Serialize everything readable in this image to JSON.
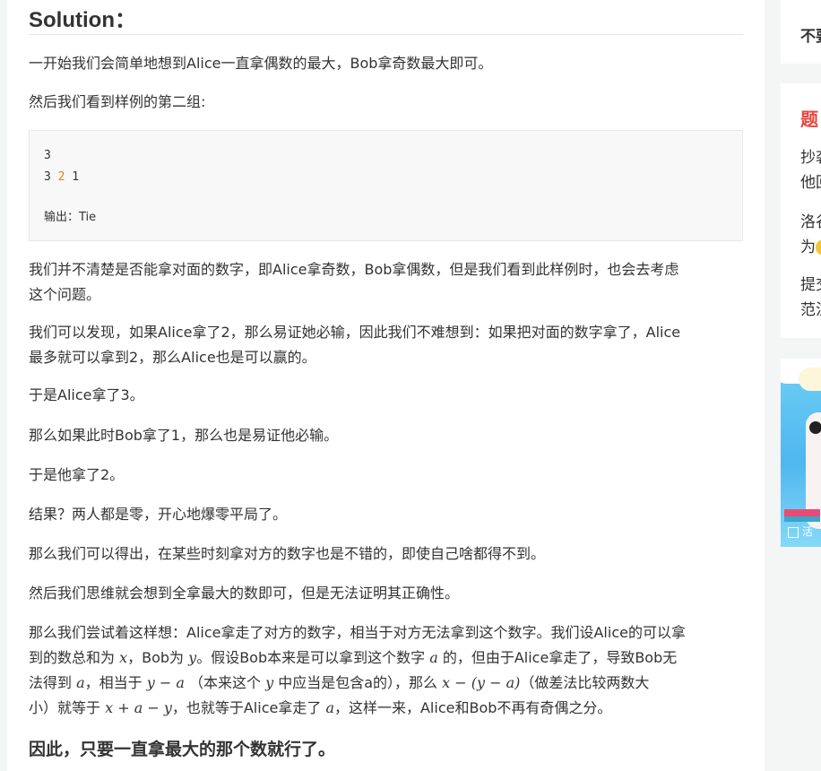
{
  "heading": "Solution：",
  "para1": "一开始我们会简单地想到Alice一直拿偶数的最大，Bob拿奇数最大即可。",
  "para2": "然后我们看到样例的第二组:",
  "code": {
    "line1": "3",
    "line2_a": "3 ",
    "line2_b": "2",
    "line2_c": " 1",
    "line4": "输出：Tie"
  },
  "para3_l1": "我们并不清楚是否能拿对面的数字，即Alice拿奇数，Bob拿偶数，但是我们看到此样例时，也会去考虑",
  "para3_l2": "这个问题。",
  "para4_l1": "我们可以发现，如果Alice拿了2，那么易证她必输，因此我们不难想到：如果把对面的数字拿了，Alice",
  "para4_l2": "最多就可以拿到2，那么Alice也是可以赢的。",
  "para5": "于是Alice拿了3。",
  "para6": "那么如果此时Bob拿了1，那么也是易证他必输。",
  "para7": "于是他拿了2。",
  "para8": "结果？两人都是零，开心地爆零平局了。",
  "para9": "那么我们可以得出，在某些时刻拿对方的数字也是不错的，即使自己啥都得不到。",
  "para10": "然后我们思维就会想到全拿最大的数即可，但是无法证明其正确性。",
  "para11": {
    "l1": "那么我们尝试着这样想：Alice拿走了对方的数字，相当于对方无法拿到这个数字。我们设Alice的可以拿",
    "l2_a": "到的数总和为 ",
    "l2_x": "x",
    "l2_b": "，Bob为 ",
    "l2_y": "y",
    "l2_c": "。假设Bob本来是可以拿到这个数字 ",
    "l2_av": "a",
    "l2_d": " 的，但由于Alice拿走了，导致Bob无",
    "l3_a": "法得到 ",
    "l3_av": "a",
    "l3_b": "，相当于 ",
    "l3_expr1": "y − a",
    "l3_c": " （本来这个 ",
    "l3_y": "y",
    "l3_d": " 中应当是包含a的），那么 ",
    "l3_expr2": "x − (y − a)",
    "l3_e": "（做差法比较两数大",
    "l4_a": "小）就等于 ",
    "l4_expr": "x + a − y",
    "l4_b": "，也就等于Alice拿走了 ",
    "l4_av": "a",
    "l4_c": "，这样一来，Alice和Bob不再有奇偶之分。"
  },
  "conclusion": "因此，只要一直拿最大的那个数就行了。",
  "sidebar": {
    "card1_text": "不要",
    "card2_title": "题",
    "card2_lines": [
      "抄袭",
      "他回",
      "洛谷",
      "为",
      "提交",
      "范注"
    ],
    "banner_label": "活"
  },
  "colors": {
    "accent_red": "#e8453c",
    "code_orange": "#e08030"
  }
}
